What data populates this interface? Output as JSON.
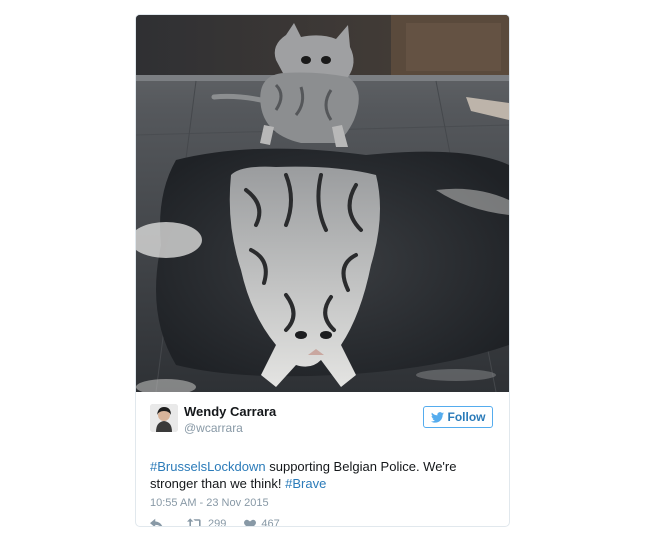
{
  "tweet": {
    "author_name": "Wendy Carrara",
    "author_handle": "@wcarrara",
    "follow_label": "Follow",
    "text": {
      "hashtag1": "#BrusselsLockdown",
      "body": " supporting Belgian Police. We're stronger than we think! ",
      "hashtag2": "#Brave"
    },
    "timestamp": "10:55 AM - 23 Nov 2015",
    "retweets": "299",
    "likes": "467"
  },
  "icons": {
    "reply": "reply-icon",
    "retweet": "retweet-icon",
    "like": "heart-icon",
    "follow": "twitter-bird-icon"
  },
  "colors": {
    "link": "#2b7bb9",
    "follow_border": "#55acee",
    "muted": "#8899a6",
    "text": "#14171a"
  }
}
